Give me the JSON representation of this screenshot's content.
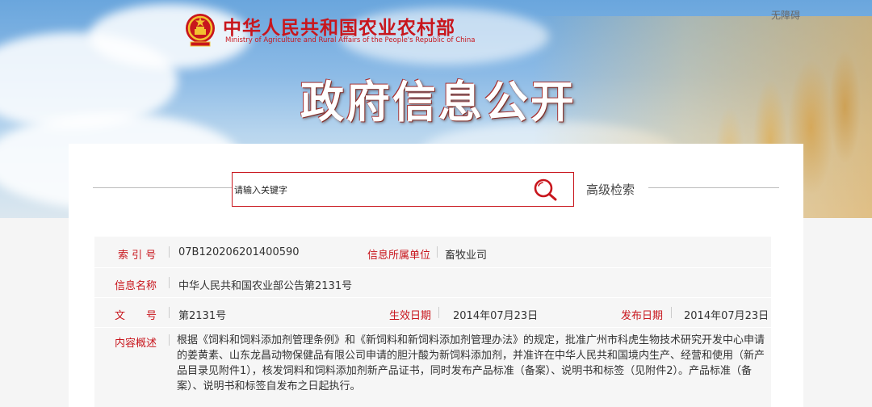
{
  "header": {
    "accessibility_link": "无障碍",
    "ministry_cn": "中华人民共和国农业农村部",
    "ministry_en": "Ministry of Agriculture and Rural Affairs of the People's Republic of China",
    "hero_title": "政府信息公开"
  },
  "search": {
    "placeholder": "请输入关键字",
    "advanced_label": "高级检索"
  },
  "info": {
    "index_label": "索 引 号",
    "index_value": "07B120206201400590",
    "org_label": "信息所属单位",
    "org_value": "畜牧业司",
    "name_label": "信息名称",
    "name_value": "中华人民共和国农业部公告第2131号",
    "doc_label": "文　　号",
    "doc_value": "第2131号",
    "effective_label": "生效日期",
    "effective_value": "2014年07月23日",
    "publish_label": "发布日期",
    "publish_value": "2014年07月23日",
    "summary_label": "内容概述",
    "summary_value": "根据《饲料和饲料添加剂管理条例》和《新饲料和新饲料添加剂管理办法》的规定，批准广州市科虎生物技术研究开发中心申请的姜黄素、山东龙昌动物保健品有限公司申请的胆汁酸为新饲料添加剂，并准许在中华人民共和国境内生产、经营和使用（新产品目录见附件1），核发饲料和饲料添加剂新产品证书，同时发布产品标准（备案）、说明书和标签（见附件2）。产品标准（备案）、说明书和标签自发布之日起执行。"
  },
  "colors": {
    "accent_red": "#c8161d"
  }
}
